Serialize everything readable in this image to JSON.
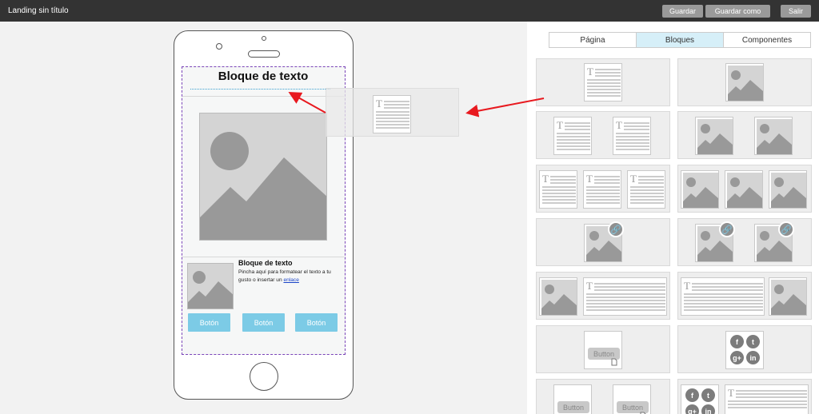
{
  "topbar": {
    "title": "Landing sin título",
    "save_label": "Guardar",
    "save_as_label": "Guardar como",
    "exit_label": "Salir"
  },
  "canvas": {
    "heading": "Bloque de texto",
    "text_block": {
      "title": "Bloque de texto",
      "body": "Pincha aquí para formatear el texto a tu gusto o insertar un",
      "link": "enlace"
    },
    "buttons": [
      "Botón",
      "Botón",
      "Botón"
    ]
  },
  "panel": {
    "tabs": [
      {
        "label": "Página",
        "active": false
      },
      {
        "label": "Bloques",
        "active": true
      },
      {
        "label": "Componentes",
        "active": false
      }
    ],
    "block_button_label": "Button",
    "social_icons": [
      "f",
      "t",
      "g+",
      "in"
    ]
  },
  "colors": {
    "topbar": "#333333",
    "active_tab": "#d6eff8",
    "cta": "#7ccbe6",
    "selection_border": "#7a44b8",
    "arrow": "#e8191f"
  }
}
